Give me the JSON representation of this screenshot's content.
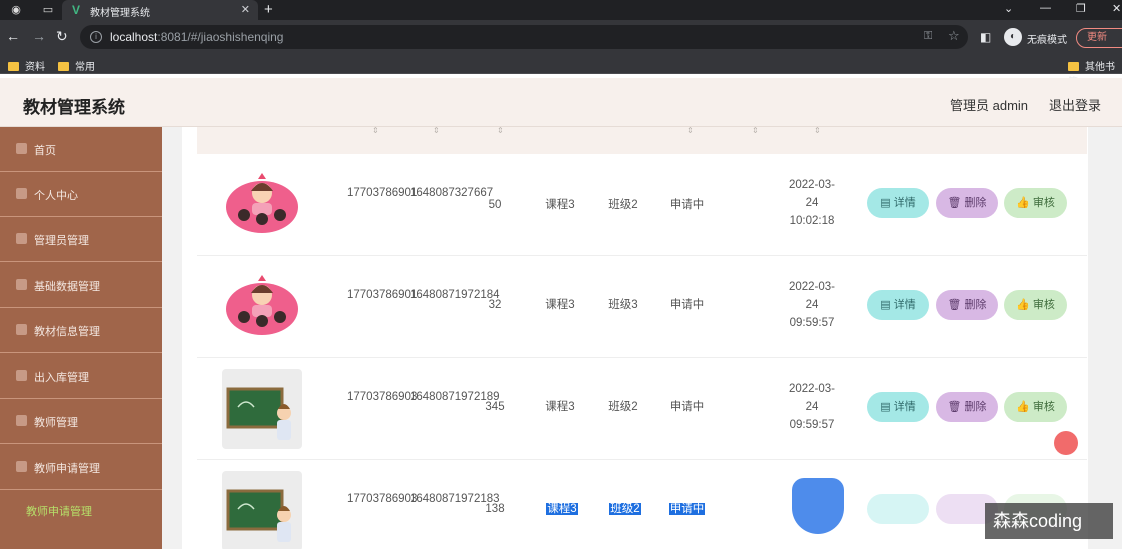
{
  "browser": {
    "tab_title": "教材管理系统",
    "url_host": "localhost",
    "url_path": ":8081/#/jiaoshishenqing",
    "incognito_label": "无痕模式",
    "update_label": "更新",
    "bookmarks": [
      "资料",
      "常用",
      "其他书签"
    ]
  },
  "header": {
    "app_title": "教材管理系统",
    "admin": "管理员 admin",
    "logout": "退出登录"
  },
  "sidebar": {
    "items": [
      {
        "label": "首页",
        "icon": "home-icon"
      },
      {
        "label": "个人中心",
        "icon": "user-icon"
      },
      {
        "label": "管理员管理",
        "icon": "admin-icon"
      },
      {
        "label": "基础数据管理",
        "icon": "data-icon"
      },
      {
        "label": "教材信息管理",
        "icon": "book-icon"
      },
      {
        "label": "出入库管理",
        "icon": "storage-icon"
      },
      {
        "label": "教师管理",
        "icon": "teacher-icon"
      },
      {
        "label": "教师申请管理",
        "icon": "apply-icon"
      }
    ],
    "sub_item": "教师申请管理"
  },
  "table": {
    "rows": [
      {
        "phone": "17703786901",
        "number": "1648087327667",
        "qty": "50",
        "course": "课程3",
        "class": "班级2",
        "status": "申请中",
        "time": "2022-03-24 10:02:18",
        "thumb": "cartoon-kids"
      },
      {
        "phone": "17703786901",
        "number": "16480871972184",
        "qty": "32",
        "course": "课程3",
        "class": "班级3",
        "status": "申请中",
        "time": "2022-03-24 09:59:57",
        "thumb": "cartoon-kids"
      },
      {
        "phone": "17703786903",
        "number": "16480871972189",
        "qty": "345",
        "course": "课程3",
        "class": "班级2",
        "status": "申请中",
        "time": "2022-03-24 09:59:57",
        "thumb": "teacher-board"
      },
      {
        "phone": "17703786903",
        "number": "16480871972183",
        "qty": "138",
        "course": "课程3",
        "class": "班级2",
        "status": "申请中",
        "time": "",
        "thumb": "teacher-board"
      }
    ],
    "actions": {
      "detail": "详情",
      "delete": "删除",
      "audit": "审核"
    }
  },
  "watermark": "森森coding",
  "colors": {
    "sidebar": "#a0654a",
    "header": "#f7f0ec",
    "active_sub": "#b6e06a"
  }
}
